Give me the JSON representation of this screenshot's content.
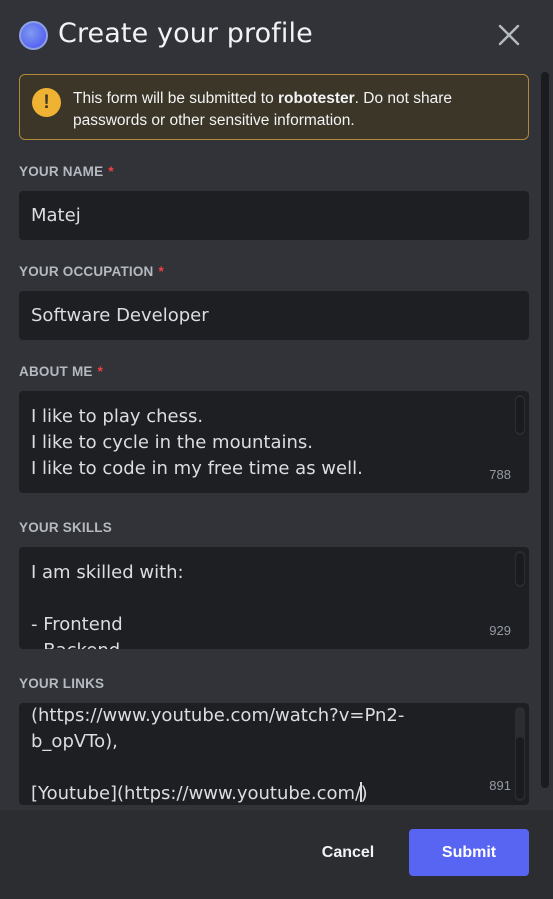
{
  "modal": {
    "title": "Create your profile",
    "accent": "#5865f2"
  },
  "notice": {
    "prefix": "This form will be submitted to ",
    "app": "robotester",
    "suffix": ". Do not share passwords or other sensitive information."
  },
  "fields": {
    "name": {
      "label": "YOUR NAME",
      "required": "*",
      "value": "Matej"
    },
    "occupation": {
      "label": "YOUR OCCUPATION",
      "required": "*",
      "value": "Software Developer"
    },
    "about": {
      "label": "ABOUT ME",
      "required": "*",
      "lines": [
        "I like to play chess.",
        "I like to cycle in the mountains.",
        "I like to code in my free time as well."
      ],
      "counter": "788"
    },
    "skills": {
      "label": "YOUR SKILLS",
      "lines": [
        "I am skilled with:",
        "",
        "- Frontend",
        "- Backend"
      ],
      "counter": "929"
    },
    "links": {
      "label": "YOUR LINKS",
      "lines": [
        "(https://www.youtube.com/watch?v=Pn2-",
        "b_opVTo),",
        "",
        "[Youtube](https://www.youtube.com/)"
      ],
      "counter": "891"
    }
  },
  "footer": {
    "cancel_label": "Cancel",
    "submit_label": "Submit"
  },
  "icons": {
    "app": "app-avatar-icon",
    "close": "close-icon",
    "warning": "warning-icon"
  }
}
